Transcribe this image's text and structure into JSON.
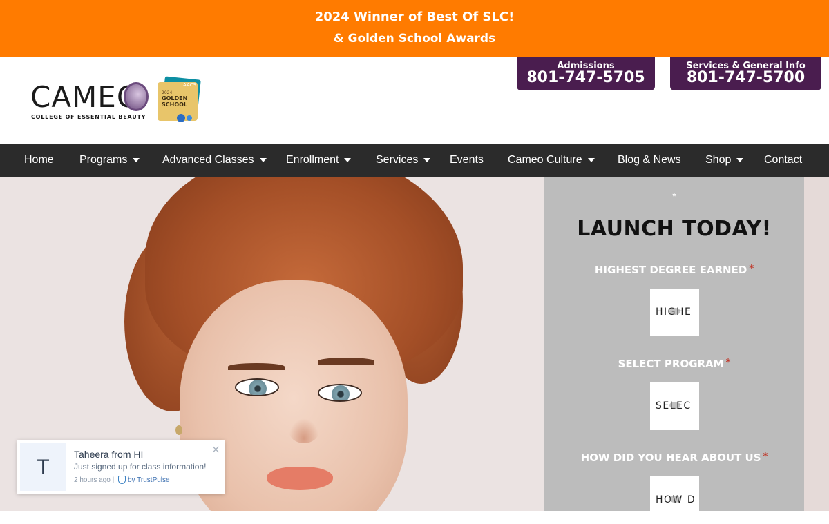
{
  "banner": {
    "line1": "2024 Winner of Best Of SLC!",
    "line2": "& Golden School Awards",
    "background": "#ff7b00"
  },
  "header": {
    "logo": {
      "wordmark": "CAMEO",
      "tagline": "COLLEGE OF ESSENTIAL BEAUTY"
    },
    "award_badge": {
      "org": "AACS",
      "year": "2024",
      "title": "GOLDEN SCHOOL"
    },
    "phones": [
      {
        "label": "Admissions",
        "number": "801-747-5705"
      },
      {
        "label": "Services & General Info",
        "number": "801-747-5700"
      }
    ],
    "phone_background": "#4a1d4f"
  },
  "nav": {
    "background": "#2b2b2b",
    "items": [
      {
        "label": "Home"
      },
      {
        "label": "Programs"
      },
      {
        "label": "Advanced Classes"
      },
      {
        "label": "Enrollment"
      },
      {
        "label": "Services"
      },
      {
        "label": "Events"
      },
      {
        "label": "Cameo Culture"
      },
      {
        "label": "Blog & News"
      },
      {
        "label": "Shop"
      },
      {
        "label": "Contact"
      }
    ]
  },
  "form": {
    "required_marker": "*",
    "title": "LAUNCH TODAY!",
    "fields": [
      {
        "label": "HIGHEST DEGREE EARNED",
        "required": "*",
        "value": "HIGHE"
      },
      {
        "label": "SELECT PROGRAM",
        "required": "*",
        "value": "SELEC"
      },
      {
        "label": "HOW DID YOU HEAR ABOUT US",
        "required": "*",
        "value": "HOW D"
      }
    ]
  },
  "notification": {
    "initial": "T",
    "name": "Taheera from HI",
    "message": "Just signed up for class information!",
    "time": "2 hours ago |",
    "provider": "by TrustPulse",
    "close": "×"
  }
}
